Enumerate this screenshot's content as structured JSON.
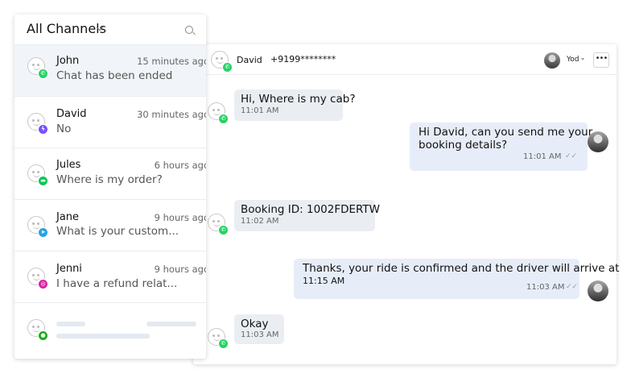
{
  "sidebar": {
    "title": "All Channels",
    "conversations": [
      {
        "name": "John",
        "time": "15 minutes ago",
        "preview": "Chat has been ended",
        "channel": "whatsapp",
        "channel_icon": "whatsapp-icon",
        "channel_color": "#25d366",
        "active": true
      },
      {
        "name": "David",
        "time": "30 minutes ago",
        "preview": "No",
        "channel": "messenger",
        "channel_icon": "messenger-icon",
        "channel_color": "#7b4fff",
        "active": false
      },
      {
        "name": "Jules",
        "time": "6 hours ago",
        "preview": "Where is my order?",
        "channel": "line",
        "channel_icon": "line-icon",
        "channel_color": "#06c755",
        "active": false
      },
      {
        "name": "Jane",
        "time": "9 hours ago",
        "preview": "What is your custom...",
        "channel": "telegram",
        "channel_icon": "telegram-icon",
        "channel_color": "#2aa3df",
        "active": false
      },
      {
        "name": "Jenni",
        "time": "9 hours ago",
        "preview": "I have a refund relat...",
        "channel": "instagram",
        "channel_icon": "instagram-icon",
        "channel_color": "#d6249f",
        "active": false
      },
      {
        "name": "",
        "time": "",
        "preview": "",
        "channel": "wechat",
        "channel_icon": "wechat-icon",
        "channel_color": "#1aad19",
        "loading": true
      }
    ]
  },
  "chat": {
    "contact_name": "David",
    "contact_phone": "+9199********",
    "channel_icon": "whatsapp-icon",
    "agent_name": "Yod",
    "messages": [
      {
        "direction": "in",
        "lines": [
          "Hi, Where is my cab?"
        ],
        "time": "11:01 AM"
      },
      {
        "direction": "out",
        "lines": [
          "Hi David, can you send me your",
          "booking details?"
        ],
        "time": "11:01 AM",
        "read": true
      },
      {
        "direction": "in",
        "lines": [
          "Booking ID: 1002FDERTW"
        ],
        "time": "11:02 AM"
      },
      {
        "direction": "out",
        "lines": [
          "Thanks, your ride is confirmed and the driver will arrive at",
          "11:15 AM"
        ],
        "time": "11:03 AM",
        "read": true
      },
      {
        "direction": "in",
        "lines": [
          "Okay"
        ],
        "time": "11:03 AM"
      }
    ]
  },
  "colors": {
    "accent_bg": "#f1f5f9",
    "outgoing_bubble": "#e7edf8",
    "incoming_bubble": "#eaeef3",
    "whatsapp": "#25d366"
  }
}
